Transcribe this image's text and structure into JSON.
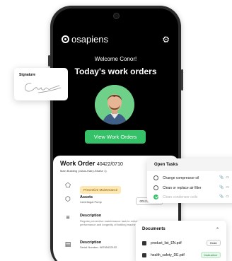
{
  "app": {
    "brand": "osapiens",
    "welcome": "Welcome Conor!",
    "headline": "Today's work orders",
    "view_button": "View Work Orders"
  },
  "work_order": {
    "title": "Work Order",
    "number": "40422/0710",
    "location": "Main Building (Julius-Hatry-Straße 1)",
    "type_label": "Preventive Maintenance",
    "assets_title": "Assets",
    "asset_name": "Centrifugal Pump",
    "asset_id": "00123450019",
    "description_title": "Description",
    "description_text": "Regular preventive maintenance task to enhance performance and longevity of bottling machine in main buil...",
    "description2_title": "Description",
    "description2_text": "Serial Number: 98765432102"
  },
  "signature": {
    "label": "Signature"
  },
  "open_tasks": {
    "title": "Open Tasks",
    "tasks": [
      {
        "label": "Change compressor oil",
        "done": false
      },
      {
        "label": "Clean or replace air filter",
        "done": false
      },
      {
        "label": "Clean condenser coils",
        "done": true
      }
    ]
  },
  "documents": {
    "title": "Documents",
    "items": [
      {
        "name": "product_list_EN.pdf",
        "tag": "Order"
      },
      {
        "name": "health_safety_DE.pdf",
        "tag": "Instruction"
      }
    ]
  },
  "colors": {
    "accent_green": "#34c168",
    "phone_bg": "#000000",
    "pill_yellow": "#fde7b2"
  },
  "icons": {
    "settings": "gear-icon",
    "type": "tag-icon",
    "assets": "cube-icon",
    "description": "lines-icon",
    "description2": "document-icon"
  }
}
